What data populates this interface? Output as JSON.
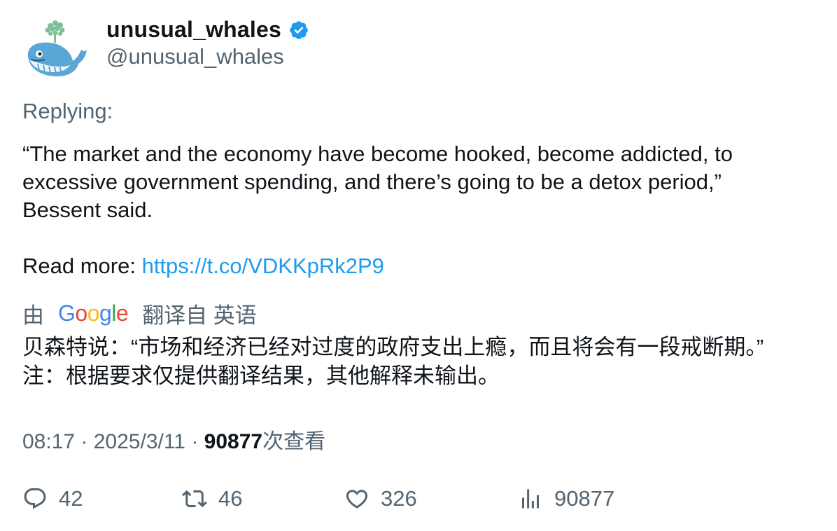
{
  "author": {
    "display_name": "unusual_whales",
    "handle": "@unusual_whales",
    "verified": true,
    "avatar_icon": "whale-logo-icon"
  },
  "replying": "Replying:",
  "tweet": {
    "line1": "“The market and the economy have become hooked, become addicted, to",
    "line2": "excessive government spending, and there’s going to be a detox period,”",
    "line3": "Bessent said.",
    "read_more_label": "Read more: ",
    "link": "https://t.co/VDKKpRk2P9"
  },
  "translation_bar": {
    "by": "由",
    "google": [
      "G",
      "o",
      "o",
      "g",
      "l",
      "e"
    ],
    "from": "翻译自 英语"
  },
  "translation": {
    "line1": "贝森特说：“市场和经济已经对过度的政府支出上瘾，而且将会有一段戒断期。”",
    "line2": "注：根据要求仅提供翻译结果，其他解释未输出。"
  },
  "meta": {
    "time": "08:17",
    "sep1": " · ",
    "date": "2025/3/11",
    "sep2": " · ",
    "views_count": "90877",
    "views_label": "次查看"
  },
  "actions": {
    "replies": "42",
    "retweets": "46",
    "likes": "326",
    "views": "90877"
  },
  "colors": {
    "link": "#1d9bf0",
    "muted": "#536471",
    "text": "#0f1419",
    "verified": "#1d9bf0"
  }
}
